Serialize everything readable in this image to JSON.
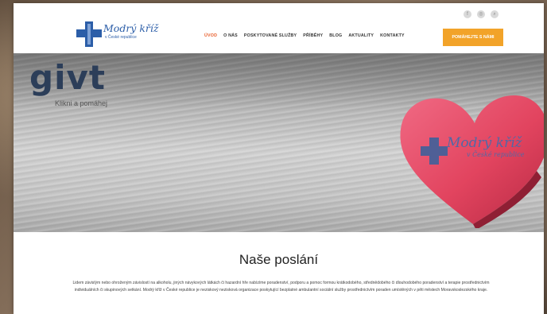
{
  "brand": {
    "name": "Modrý kříž",
    "subtitle": "v České republice",
    "primary_color": "#2c5ea8",
    "accent_color": "#f2a329"
  },
  "social": [
    {
      "icon": "facebook-icon",
      "glyph": "f"
    },
    {
      "icon": "instagram-icon",
      "glyph": "◎"
    },
    {
      "icon": "search-icon",
      "glyph": "⌕"
    }
  ],
  "nav": {
    "items": [
      {
        "label": "ÚVOD"
      },
      {
        "label": "O NÁS"
      },
      {
        "label": "POSKYTOVANÉ SLUŽBY"
      },
      {
        "label": "PŘÍBĚHY"
      },
      {
        "label": "BLOG"
      },
      {
        "label": "AKTUALITY"
      },
      {
        "label": "KONTAKTY"
      }
    ],
    "cta_label": "POMÁHEJTE S NÁMI"
  },
  "hero": {
    "givt_word": "givt",
    "givt_tagline": "Klikni a pomáhej",
    "heart_name": "Modrý kříž",
    "heart_subtitle": "v České republice"
  },
  "mission": {
    "title": "Naše poslání",
    "text": "Lidem závislým nebo ohroženým závislostí na alkoholu, jiných návykových látkách či hazardní hře nabízíme poradenství, podporu a pomoc formou krátkodobého, střednědobého či dlouhodobého poradenství a terapie prostřednictvím individuálních či skupinových setkání. Modrý kříž v České republice je neziskový nezisková organizace poskytující bezplatné ambulantní sociální služby prostřednictvím poraden umístěných v pěti městech Moravskoslezského kraje."
  }
}
